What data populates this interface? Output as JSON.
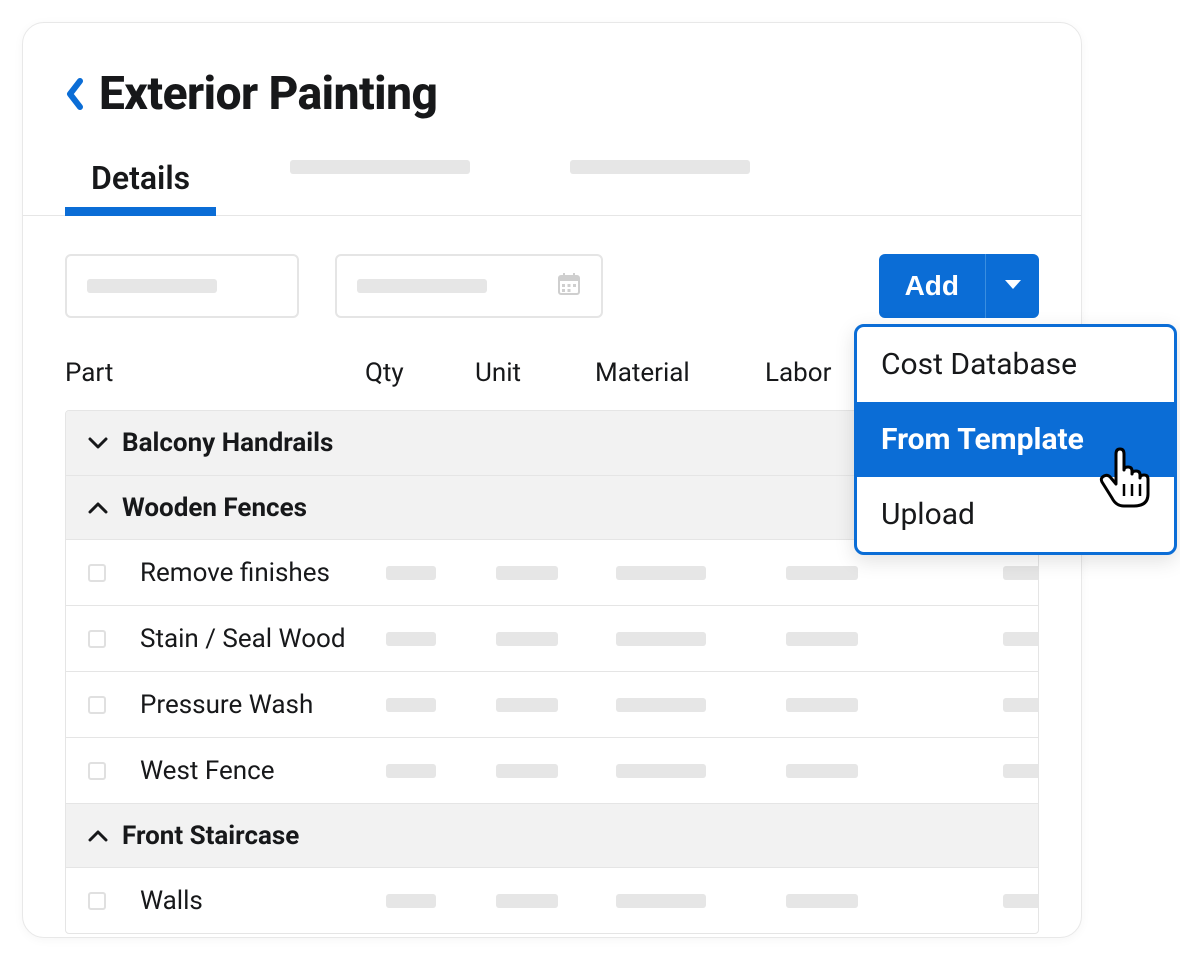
{
  "header": {
    "title": "Exterior Painting"
  },
  "tabs": {
    "active": "Details"
  },
  "toolbar": {
    "add_label": "Add"
  },
  "columns": {
    "part": "Part",
    "qty": "Qty",
    "unit": "Unit",
    "material": "Material",
    "labor": "Labor"
  },
  "groups": [
    {
      "name": "Balcony Handrails",
      "expanded": false,
      "rows": []
    },
    {
      "name": "Wooden Fences",
      "expanded": true,
      "rows": [
        {
          "label": "Remove finishes"
        },
        {
          "label": "Stain / Seal Wood"
        },
        {
          "label": "Pressure Wash"
        },
        {
          "label": "West Fence"
        }
      ]
    },
    {
      "name": "Front Staircase",
      "expanded": true,
      "rows": [
        {
          "label": "Walls"
        }
      ]
    }
  ],
  "dropdown": {
    "items": [
      {
        "label": "Cost Database",
        "highlight": false
      },
      {
        "label": "From Template",
        "highlight": true
      },
      {
        "label": "Upload",
        "highlight": false
      }
    ]
  },
  "colors": {
    "primary": "#0b6dd6"
  }
}
